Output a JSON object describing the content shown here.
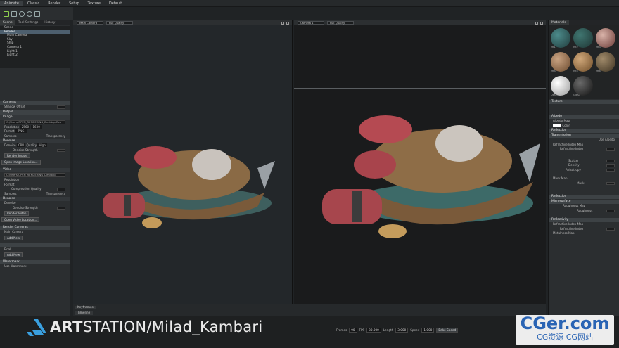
{
  "menubar": {
    "items": [
      "Animate",
      "Classic",
      "Render",
      "Setup",
      "Texture",
      "Default"
    ],
    "active_index": 0
  },
  "left_panel": {
    "tabs": [
      "Scene",
      "Tool Settings",
      "History"
    ],
    "tree": [
      "Scene",
      "Render",
      "Main Camera",
      "Sky",
      "Ship",
      "Camera 1",
      "Light 1",
      "Light 2"
    ],
    "selected": "Render",
    "sections": {
      "cameras": "Cameras",
      "shadow_offset": "Shadow Offset",
      "output": "Output",
      "image": "Image",
      "image_path": "C:/Users/OPEN_RENDERING_Desktop/Exp",
      "resolution": "Resolution",
      "res_w": "2560",
      "res_h": "1600",
      "format": "Format",
      "format_val": "PNG",
      "samples": "Samples",
      "transparency": "Transparency",
      "denoise": "Denoise",
      "denoise_val": "CPU",
      "quality": "Quality",
      "quality_val": "High",
      "denoise_strength": "Denoise Strength",
      "render_image": "Render Image",
      "open_image": "Open Image Location...",
      "video": "Video",
      "video_path": "C:/Users/OPEN_RENDERING_Desktop/",
      "compression": "Compression Quality",
      "render_video": "Render Video",
      "open_video": "Open Video Location...",
      "render_cameras": "Render Cameras",
      "main_camera": "Main Camera",
      "add_new": "Add New",
      "final": "Final",
      "add_new2": "Add New",
      "watermark": "Watermark",
      "use_watermark": "Use Watermark"
    }
  },
  "viewport_left": {
    "camera": "Main Camera",
    "quality": "Full Quality"
  },
  "viewport_right": {
    "camera": "Camera 1",
    "quality": "Full Quality"
  },
  "right_panel": {
    "title": "Materials",
    "materials": [
      "Mt1",
      "Mt2",
      "Mt3",
      "Mt4",
      "Mt5",
      "Mt6",
      "Default",
      "Glass"
    ],
    "sections": [
      "Texture",
      "Albedo",
      "Reflection",
      "Transmission",
      "Reflection",
      "Microsurface",
      "Reflectivity"
    ],
    "labels": {
      "albedo_map": "Albedo Map",
      "color": "Color",
      "use_albedo": "Use Albedo",
      "refractive_index_map": "Refractive Index Map",
      "refractive_index": "Refractive Index",
      "scatter": "Scatter",
      "density": "Density",
      "anisotropy": "Anisotropy",
      "mask_map": "Mask Map",
      "mask": "Mask",
      "roughness_map": "Roughness Map",
      "roughness": "Roughness",
      "metalness_map": "Metalness Map"
    }
  },
  "timeline": {
    "tab": "Keyframes",
    "tab2": "Timeline",
    "frames_label": "Frames",
    "frames": "90",
    "fps_label": "FPS",
    "fps": "30.000",
    "length_label": "Length",
    "length": "3.000",
    "speed_label": "Speed",
    "speed": "1.000",
    "bake": "Bake Speed"
  },
  "branding": {
    "logo_bold": "ART",
    "logo_rest": "STATION/Milad_Kambari"
  },
  "watermark": {
    "line1": "CGer.com",
    "line2": "CG资源 CG网站"
  },
  "colors": {
    "accent": "#4d5f6e",
    "logo_blue": "#3aa0e0",
    "watermark_blue": "#2a64b4"
  }
}
